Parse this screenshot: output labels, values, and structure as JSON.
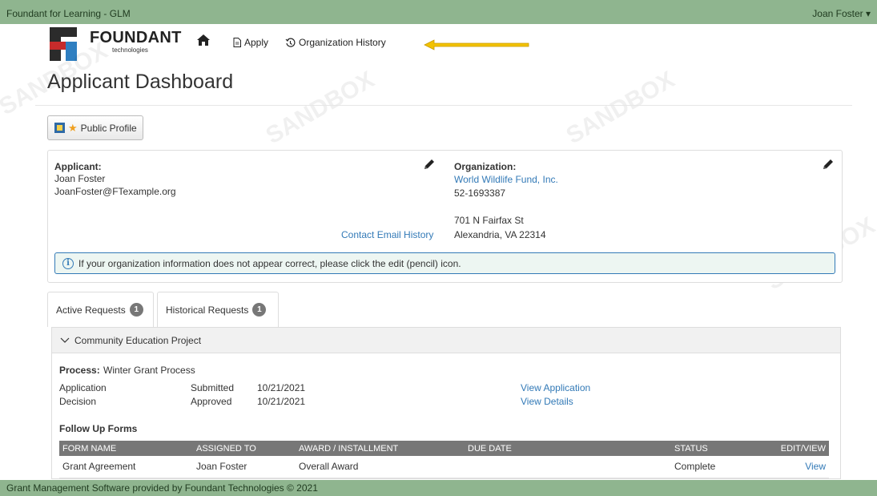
{
  "topbar": {
    "app_title": "Foundant for Learning - GLM",
    "user_name": "Joan Foster"
  },
  "nav": {
    "logo_word": "FOUNDANT",
    "logo_sub": "technologies",
    "apply_label": "Apply",
    "history_label": "Organization History"
  },
  "watermark_text": "SANDBOX",
  "page_title": "Applicant Dashboard",
  "profile_button": "Public Profile",
  "applicant": {
    "label": "Applicant:",
    "name": "Joan Foster",
    "email": "JoanFoster@FTexample.org",
    "contact_history": "Contact Email History"
  },
  "organization": {
    "label": "Organization:",
    "name": "World Wildlife Fund, Inc.",
    "ein": "52-1693387",
    "address1": "701 N Fairfax St",
    "address2": "Alexandria, VA 22314"
  },
  "alert_text": "If your organization information does not appear correct, please click the edit (pencil) icon.",
  "tabs": [
    {
      "label": "Active Requests",
      "count": "1"
    },
    {
      "label": "Historical Requests",
      "count": "1"
    }
  ],
  "request": {
    "title": "Community Education Project",
    "process_label": "Process:",
    "process_name": "Winter Grant Process",
    "rows": [
      {
        "stage": "Application",
        "status": "Submitted",
        "date": "10/21/2021",
        "link": "View Application"
      },
      {
        "stage": "Decision",
        "status": "Approved",
        "date": "10/21/2021",
        "link": "View Details"
      }
    ],
    "follow_up_title": "Follow Up Forms",
    "table_headers": [
      "FORM NAME",
      "ASSIGNED TO",
      "AWARD / INSTALLMENT",
      "DUE DATE",
      "STATUS",
      "EDIT/VIEW"
    ],
    "table_rows": [
      {
        "form_name": "Grant Agreement",
        "assigned_to": "Joan Foster",
        "award": "Overall Award",
        "due_date": "",
        "status": "Complete",
        "action": "View"
      }
    ]
  },
  "footer_text": "Grant Management Software provided by Foundant Technologies © 2021",
  "colors": {
    "bar_green": "#8fb58f",
    "link_blue": "#337ab7",
    "arrow_yellow": "#f2c200",
    "badge_gray": "#777777"
  }
}
